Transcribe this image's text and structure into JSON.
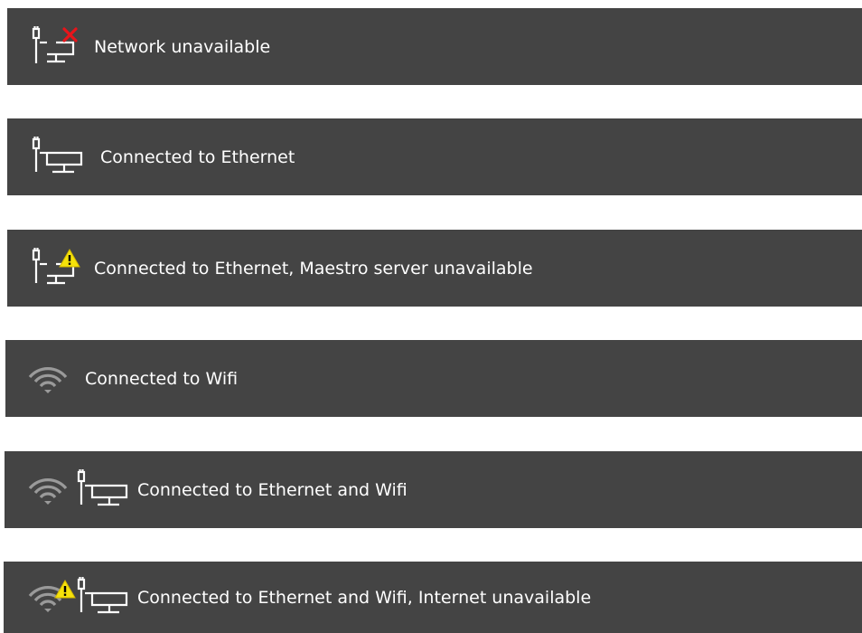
{
  "colors": {
    "bar_background": "#444444",
    "text": "#ffffff",
    "icon_primary": "#ffffff",
    "wifi_icon": "#9a9a9a",
    "error_badge": "#e8141a",
    "warning_badge": "#f5e20a"
  },
  "rows": [
    {
      "label": "Network unavailable",
      "icons": [
        "ethernet-icon",
        "error-x-icon"
      ]
    },
    {
      "label": "Connected to Ethernet",
      "icons": [
        "ethernet-icon"
      ]
    },
    {
      "label": "Connected to Ethernet, Maestro server unavailable",
      "icons": [
        "ethernet-icon",
        "warning-icon"
      ]
    },
    {
      "label": "Connected to Wifi",
      "icons": [
        "wifi-icon"
      ]
    },
    {
      "label": "Connected to Ethernet and Wifi",
      "icons": [
        "wifi-icon",
        "ethernet-icon"
      ]
    },
    {
      "label": "Connected to Ethernet and Wifi, Internet unavailable",
      "icons": [
        "wifi-icon",
        "warning-icon",
        "ethernet-icon"
      ]
    }
  ]
}
